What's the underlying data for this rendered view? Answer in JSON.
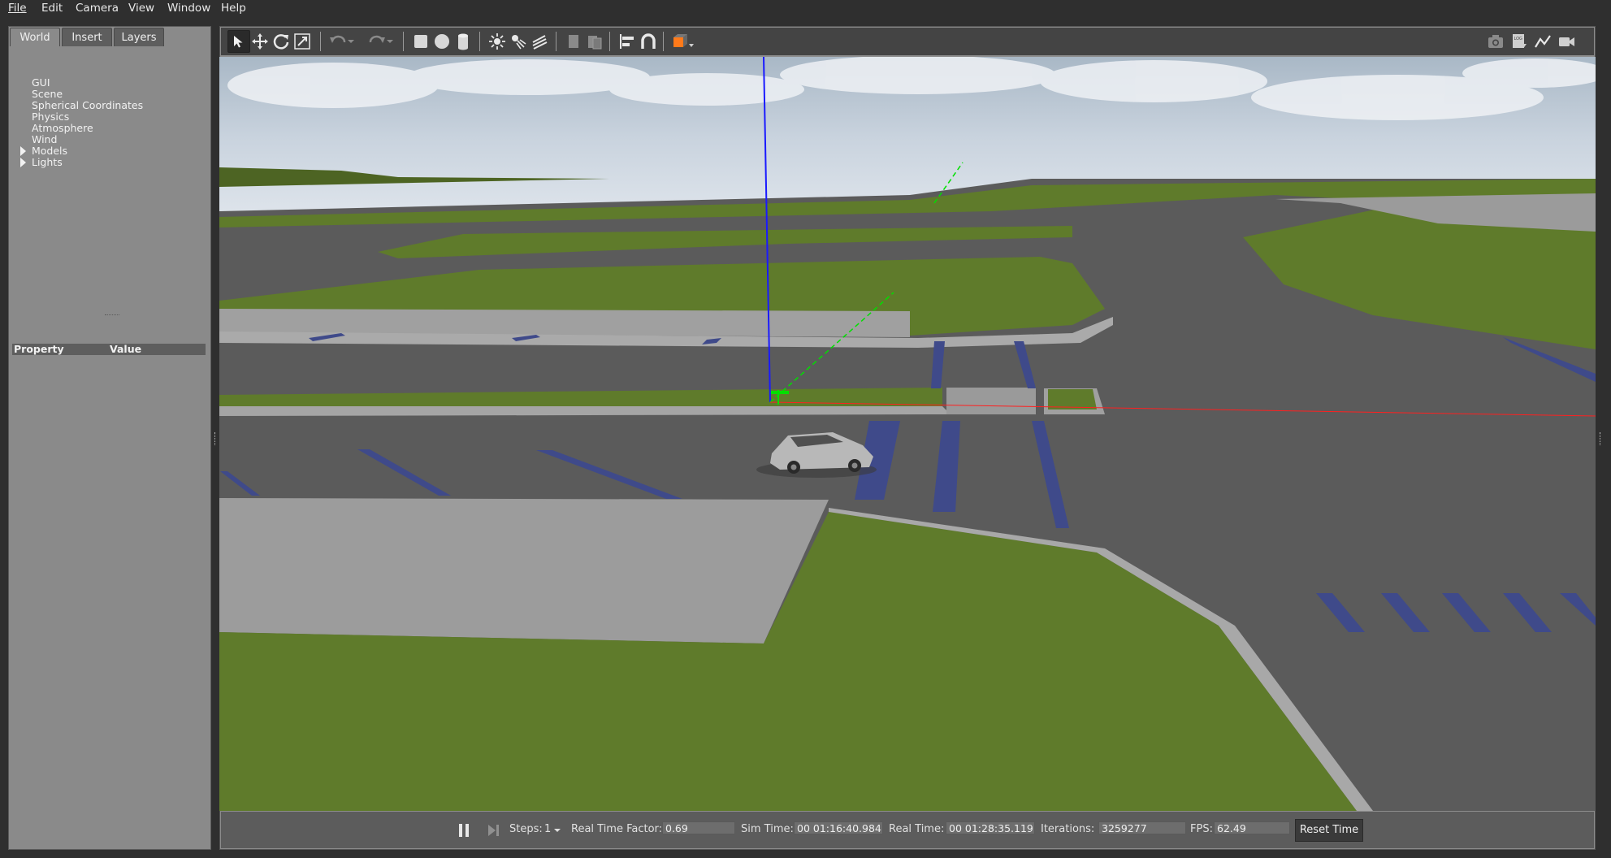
{
  "menubar": {
    "items": [
      {
        "label": "File"
      },
      {
        "label": "Edit"
      },
      {
        "label": "Camera"
      },
      {
        "label": "View"
      },
      {
        "label": "Window"
      },
      {
        "label": "Help"
      }
    ]
  },
  "left_panel": {
    "tabs": [
      {
        "label": "World",
        "active": true
      },
      {
        "label": "Insert",
        "active": false
      },
      {
        "label": "Layers",
        "active": false
      }
    ],
    "tree": [
      {
        "label": "GUI",
        "expandable": false
      },
      {
        "label": "Scene",
        "expandable": false
      },
      {
        "label": "Spherical Coordinates",
        "expandable": false
      },
      {
        "label": "Physics",
        "expandable": false
      },
      {
        "label": "Atmosphere",
        "expandable": false
      },
      {
        "label": "Wind",
        "expandable": false
      },
      {
        "label": "Models",
        "expandable": true
      },
      {
        "label": "Lights",
        "expandable": true
      }
    ],
    "property_table": {
      "col_property": "Property",
      "col_value": "Value"
    }
  },
  "toolbar": {
    "tools": [
      "select-icon",
      "translate-icon",
      "rotate-icon",
      "scale-icon",
      "undo-icon",
      "undo-history-icon",
      "redo-icon",
      "redo-history-icon",
      "box-icon",
      "sphere-icon",
      "cylinder-icon",
      "point-light-icon",
      "spot-light-icon",
      "directional-light-icon",
      "copy-icon",
      "paste-icon",
      "align-icon",
      "snap-icon",
      "view-angle-icon"
    ],
    "right_tools": [
      "screenshot-icon",
      "log-icon",
      "plot-icon",
      "video-record-icon"
    ]
  },
  "statusbar": {
    "steps_label": "Steps:",
    "steps_value": "1",
    "rtf_label": "Real Time Factor:",
    "rtf_value": "0.69",
    "sim_time_label": "Sim Time:",
    "sim_time_value": "00 01:16:40.984",
    "real_time_label": "Real Time:",
    "real_time_value": "00 01:28:35.119",
    "iterations_label": "Iterations:",
    "iterations_value": "3259277",
    "fps_label": "FPS:",
    "fps_value": "62.49",
    "reset_label": "Reset Time"
  },
  "colors": {
    "grass": "#5e7a2a",
    "road": "#5a5a5a",
    "sidewalk": "#9c9c9c",
    "lane_marking": "#3f4a8a",
    "sky": "#c9d3de",
    "axis_z": "#1a1aff",
    "axis_y": "#00e000",
    "axis_x": "#ff2020"
  }
}
